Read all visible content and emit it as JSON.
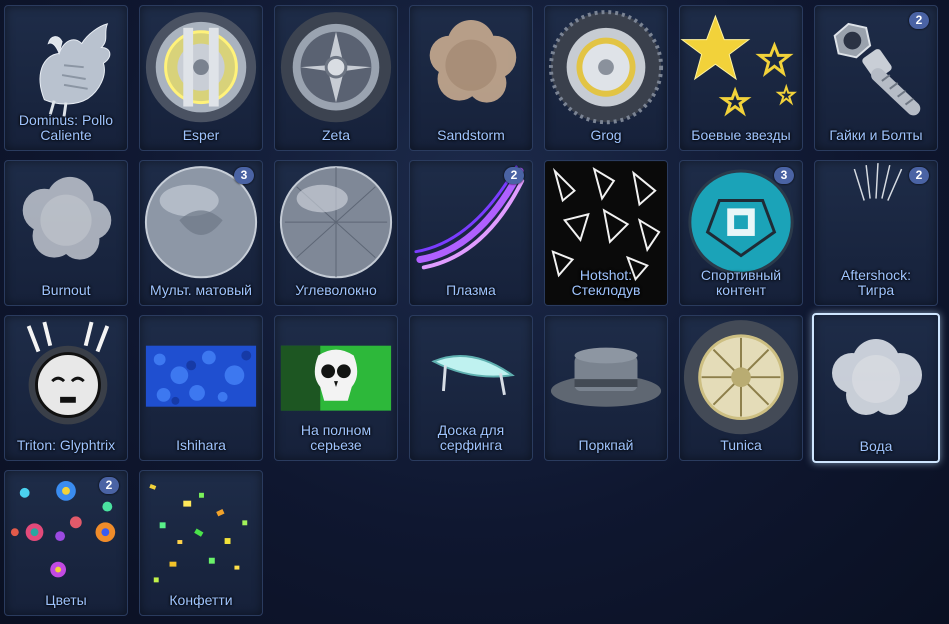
{
  "items": [
    {
      "label": "Dominus: Pollo\nCaliente",
      "badge": "",
      "icon": "rooster-decal"
    },
    {
      "label": "Esper",
      "badge": "",
      "icon": "wheel"
    },
    {
      "label": "Zeta",
      "badge": "",
      "icon": "wheel"
    },
    {
      "label": "Sandstorm",
      "badge": "",
      "icon": "dust-cloud"
    },
    {
      "label": "Grog",
      "badge": "",
      "icon": "spiked-wheel"
    },
    {
      "label": "Боевые звезды",
      "badge": "",
      "icon": "stars"
    },
    {
      "label": "Гайки и Болты",
      "badge": "2",
      "icon": "nut-and-bolt"
    },
    {
      "label": "Burnout",
      "badge": "",
      "icon": "smoke"
    },
    {
      "label": "Мульт. матовый",
      "badge": "3",
      "icon": "matte-sphere"
    },
    {
      "label": "Углеволокно",
      "badge": "",
      "icon": "carbon-sphere"
    },
    {
      "label": "Плазма",
      "badge": "2",
      "icon": "plasma-trail"
    },
    {
      "label": "Hotshot:\nСтеклодув",
      "badge": "",
      "icon": "glass-shards"
    },
    {
      "label": "Спортивный\nконтент",
      "badge": "3",
      "icon": "teal-ball"
    },
    {
      "label": "Aftershock:\nТигра",
      "badge": "2",
      "icon": "crescent-burst"
    },
    {
      "label": "Triton: Glyphtrix",
      "badge": "",
      "icon": "mask-decal"
    },
    {
      "label": "Ishihara",
      "badge": "",
      "icon": "dot-pattern"
    },
    {
      "label": "На полном\nсерьезе",
      "badge": "",
      "icon": "skull-banner"
    },
    {
      "label": "Доска для\nсерфинга",
      "badge": "",
      "icon": "surfboard"
    },
    {
      "label": "Поркпай",
      "badge": "",
      "icon": "porkpie-hat"
    },
    {
      "label": "Tunica",
      "badge": "",
      "icon": "gold-wheel"
    },
    {
      "label": "Вода",
      "badge": "",
      "icon": "water-mist"
    },
    {
      "label": "Цветы",
      "badge": "2",
      "icon": "flowers"
    },
    {
      "label": "Конфетти",
      "badge": "",
      "icon": "confetti"
    }
  ],
  "selected_index": 20,
  "colors": {
    "label": "#9fc4ff",
    "badge": "#4a63a4",
    "selected_border": "#cfe6ff"
  }
}
